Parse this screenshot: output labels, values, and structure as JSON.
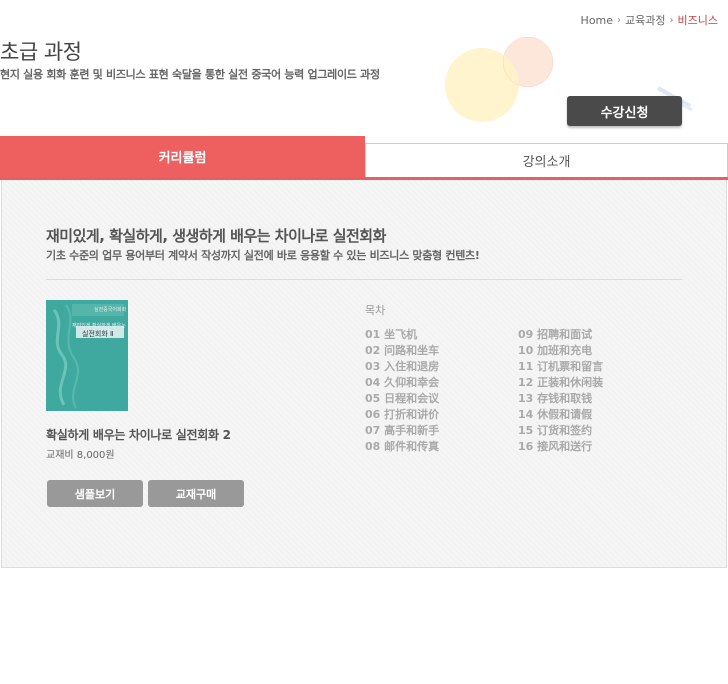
{
  "breadcrumb": {
    "home": "Home",
    "level1": "교육과정",
    "current": "비즈니스"
  },
  "header": {
    "title": "초급 과정",
    "subtitle": "현지 실용 회화 훈련 및 비즈니스 표현 숙달을 통한 실전 중국어 능력 업그레이드 과정",
    "enroll_label": "수강신청"
  },
  "tabs": [
    {
      "label": "커리큘럼",
      "active": true
    },
    {
      "label": "강의소개",
      "active": false
    }
  ],
  "content": {
    "headline": "재미있게, 확실하게, 생생하게 배우는 차이나로 실전회화",
    "subline": "기초 수준의 업무 용어부터 계약서 작성까지 실전에 바로 응용할 수 있는 비즈니스 맞춤형 컨텐츠!",
    "book": {
      "cover_series": "실전중국어회화",
      "cover_line": "재미있게 확실하게 배우는",
      "cover_title": "실전회화 Ⅱ",
      "title": "확실하게 배우는 차이나로 실전회화 2",
      "price": "교재비 8,000원",
      "sample_label": "샘플보기",
      "buy_label": "교재구매"
    },
    "toc": {
      "label": "목차",
      "col1": [
        "01 坐飞机",
        "02 问路和坐车",
        "03 入住和退房",
        "04 久仰和幸会",
        "05 日程和会议",
        "06 打折和讲价",
        "07 高手和新手",
        "08 邮件和传真"
      ],
      "col2": [
        "09 招聘和面试",
        "10 加班和充电",
        "11 订机票和留言",
        "12 正装和休闲装",
        "13 存钱和取钱",
        "14 休假和请假",
        "15 订货和签约",
        "16 接风和送行"
      ]
    }
  },
  "colors": {
    "accent": "#ee6060",
    "dark_button": "#4a4a4a",
    "gray_button": "#999999",
    "breadcrumb_current": "#d23a3a"
  }
}
